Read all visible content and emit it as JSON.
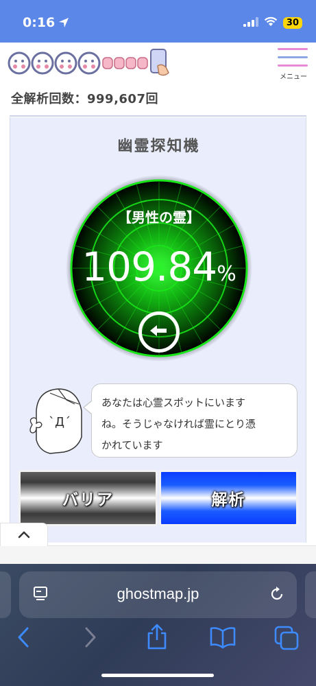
{
  "status_bar": {
    "time": "0:16",
    "battery": "30"
  },
  "header": {
    "menu_label": "メニュー"
  },
  "stats": {
    "total_analyses": "全解析回数：999,607回"
  },
  "detector": {
    "title": "幽霊探知機",
    "ghost_type": "【男性の霊】",
    "percentage": "109.84",
    "percent_sign": "%",
    "level": 109.84
  },
  "message": {
    "lines": [
      "あなたは心霊スポットにいます",
      "ね。そうじゃなければ霊にとり憑",
      "かれています"
    ]
  },
  "buttons": {
    "barrier": "バリア",
    "analyze": "解析"
  },
  "browser": {
    "url": "ghostmap.jp"
  },
  "colors": {
    "status_bar": "#5b87e9",
    "radar_green": "#19e619",
    "panel_bg": "#e9edfc",
    "analyze_blue": "#0a3cff"
  },
  "icons": [
    "location-arrow-icon",
    "signal-icon",
    "wifi-icon",
    "hamburger-menu-icon",
    "back-arrow-icon",
    "tabs-icon",
    "reload-icon",
    "back-icon",
    "forward-icon",
    "share-icon",
    "bookmarks-icon",
    "tabs-overview-icon",
    "chevron-up-icon"
  ]
}
